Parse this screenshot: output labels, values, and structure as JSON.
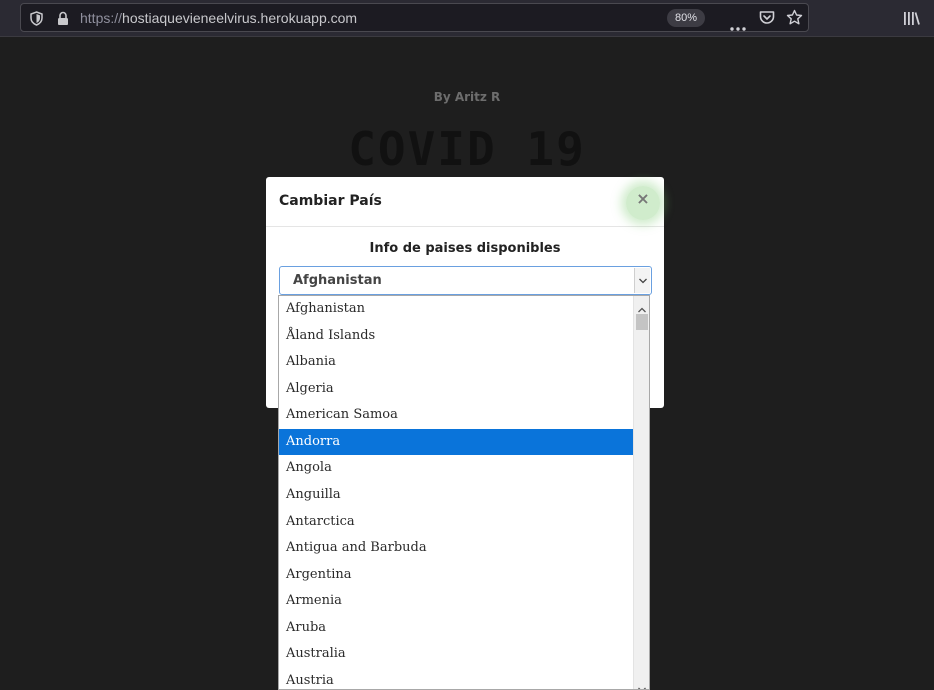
{
  "browser": {
    "url_protocol": "https://",
    "url_host": "hostiaquevieneelvirus.herokuapp.com",
    "zoom": "80%"
  },
  "page": {
    "byline": "By Aritz R",
    "title": "COVID 19"
  },
  "modal": {
    "title": "Cambiar País",
    "close_label": "×",
    "label": "Info de paises disponibles",
    "selected_value": "Afghanistan"
  },
  "dropdown": {
    "options": [
      "Afghanistan",
      "Åland Islands",
      "Albania",
      "Algeria",
      "American Samoa",
      "Andorra",
      "Angola",
      "Anguilla",
      "Antarctica",
      "Antigua and Barbuda",
      "Argentina",
      "Armenia",
      "Aruba",
      "Australia",
      "Austria"
    ],
    "highlighted": "Andorra"
  },
  "colors": {
    "highlight": "#0a74da",
    "page_bg": "#1e1e1e",
    "toolbar_bg": "#2b2a33"
  }
}
